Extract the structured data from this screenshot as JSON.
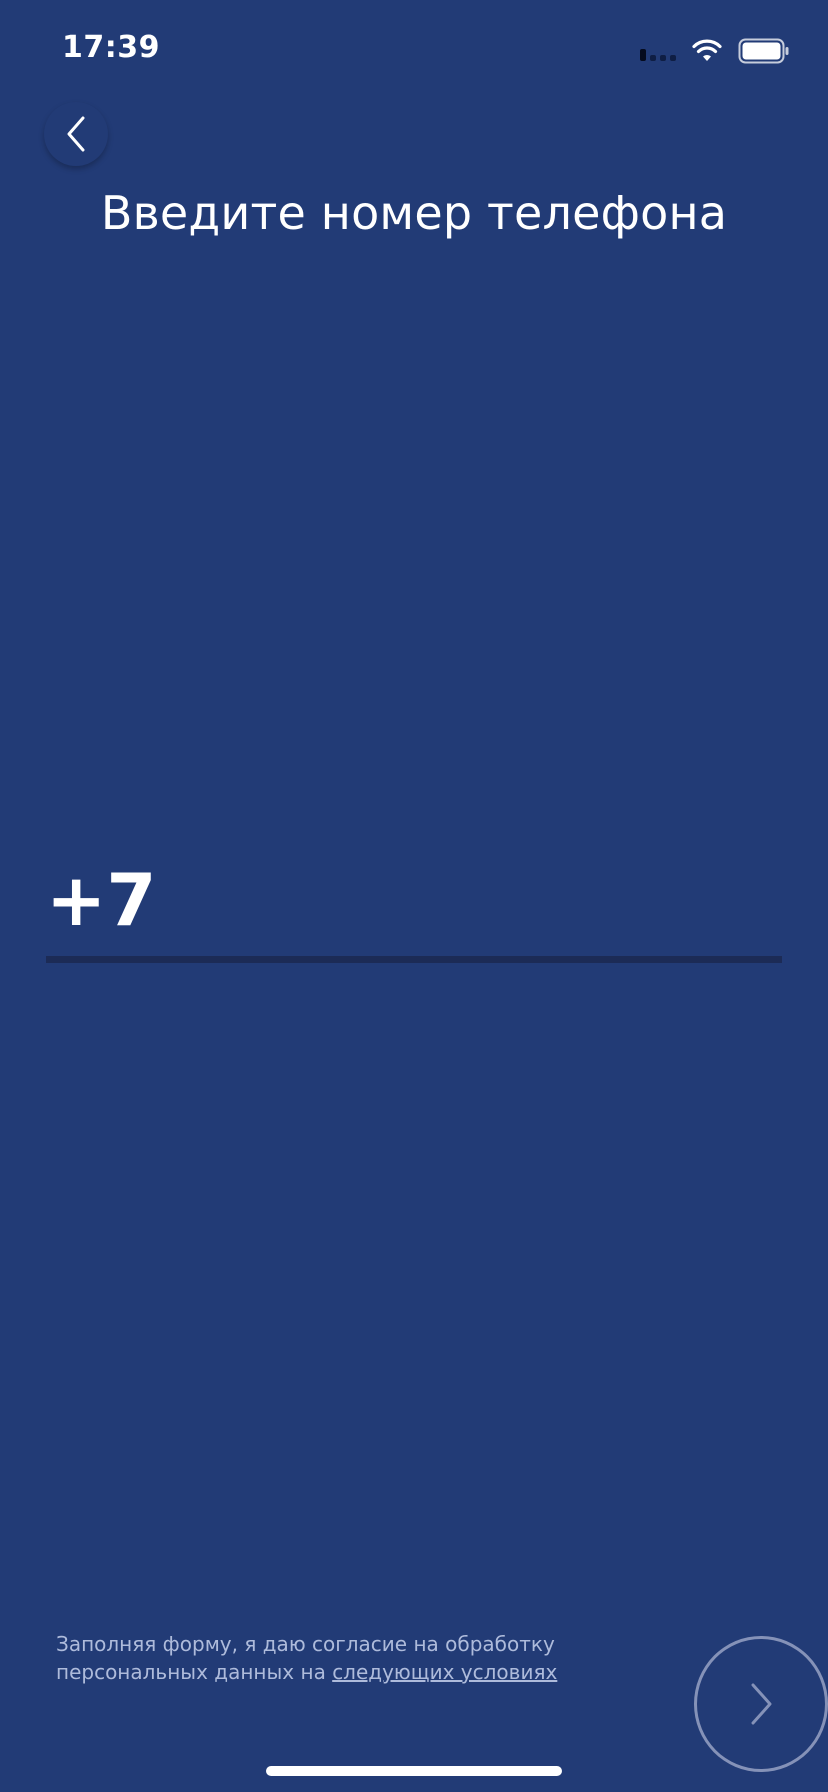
{
  "status_bar": {
    "time": "17:39",
    "icons": [
      "signal-icon",
      "wifi-icon",
      "battery-icon"
    ]
  },
  "header": {
    "back_icon": "chevron-left-icon",
    "title": "Введите номер телефона"
  },
  "phone_form": {
    "prefix": "+7",
    "value": "",
    "placeholder": ""
  },
  "footer": {
    "consent_text": "Заполняя форму, я даю согласие на обработку персональных данных на ",
    "consent_link": "следующих условиях",
    "next_icon": "chevron-right-icon"
  },
  "colors": {
    "background": "#223b76",
    "underline": "#1c2b56",
    "muted_text": "#aebbdb",
    "button_border": "#8592b8"
  }
}
